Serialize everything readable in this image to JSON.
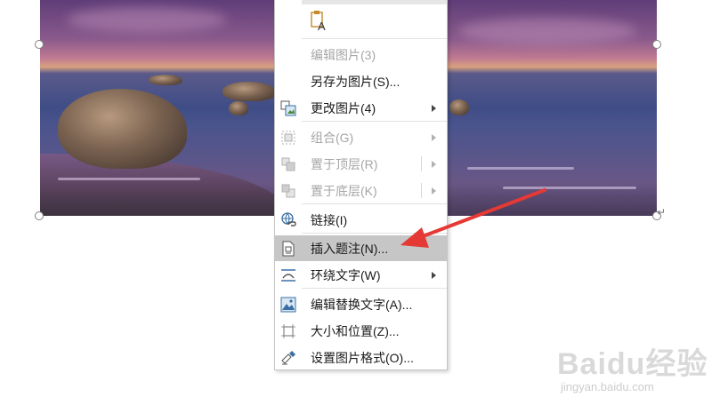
{
  "context_menu": {
    "items": [
      {
        "label": "编辑图片(3)",
        "enabled": false
      },
      {
        "label": "另存为图片(S)...",
        "enabled": true
      },
      {
        "label": "更改图片(4)",
        "enabled": true,
        "submenu": true,
        "icon": "change-picture-icon"
      },
      {
        "label": "组合(G)",
        "enabled": false,
        "submenu": true,
        "icon": "group-icon"
      },
      {
        "label": "置于顶层(R)",
        "enabled": false,
        "submenu": true,
        "icon": "bring-to-front-icon"
      },
      {
        "label": "置于底层(K)",
        "enabled": false,
        "submenu": true,
        "icon": "send-to-back-icon"
      },
      {
        "label": "链接(I)",
        "enabled": true,
        "icon": "link-icon"
      },
      {
        "label": "插入题注(N)...",
        "enabled": true,
        "highlighted": true,
        "icon": "caption-icon"
      },
      {
        "label": "环绕文字(W)",
        "enabled": true,
        "submenu": true,
        "icon": "wrap-text-icon"
      },
      {
        "label": "编辑替换文字(A)...",
        "enabled": true,
        "icon": "alt-text-icon"
      },
      {
        "label": "大小和位置(Z)...",
        "enabled": true,
        "icon": "size-position-icon"
      },
      {
        "label": "设置图片格式(O)...",
        "enabled": true,
        "icon": "format-picture-icon"
      }
    ]
  },
  "watermark": {
    "brand": "Baidu经验",
    "url": "jingyan.baidu.com"
  },
  "colors": {
    "highlight": "#c6c6c6",
    "annotation_arrow": "#e53935",
    "disabled_text": "#a6a6a6"
  }
}
